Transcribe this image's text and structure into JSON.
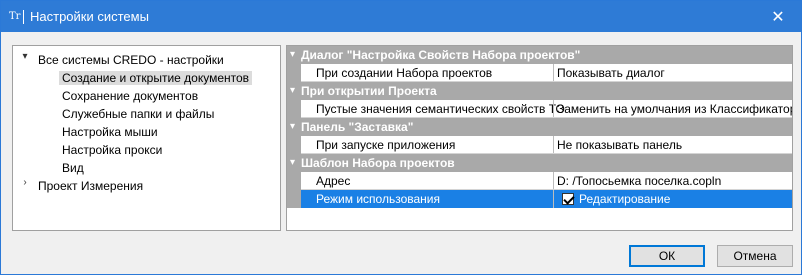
{
  "window": {
    "title": "Настройки системы",
    "icon_text": "Tr",
    "close_glyph": "✕"
  },
  "tree": {
    "root": {
      "label": "Все системы CREDO - настройки",
      "expanded": true
    },
    "children": [
      {
        "label": "Создание и открытие документов",
        "selected": true
      },
      {
        "label": "Сохранение документов"
      },
      {
        "label": "Служебные папки и файлы"
      },
      {
        "label": "Настройка мыши"
      },
      {
        "label": "Настройка прокси"
      },
      {
        "label": "Вид"
      }
    ],
    "second_root": {
      "label": "Проект Измерения",
      "expanded": false
    }
  },
  "grid": {
    "groups": [
      {
        "title": "Диалог \"Настройка Свойств Набора проектов\"",
        "rows": [
          {
            "name": "При создании Набора проектов",
            "value": "Показывать диалог"
          }
        ]
      },
      {
        "title": "При открытии Проекта",
        "rows": [
          {
            "name": "Пустые значения семантических свойств ТО",
            "value": "Заменить на умолчания из Классификатора"
          }
        ]
      },
      {
        "title": "Панель \"Заставка\"",
        "rows": [
          {
            "name": "При запуске приложения",
            "value": "Не показывать панель"
          }
        ]
      },
      {
        "title": "Шаблон Набора проектов",
        "rows": [
          {
            "name": "Адрес",
            "value": "D: /Топосьемка поселка.copln"
          },
          {
            "name": "Режим использования",
            "value": "Редактирование",
            "checked": true,
            "selected": true
          }
        ]
      }
    ]
  },
  "buttons": {
    "ok": "ОК",
    "cancel": "Отмена"
  },
  "colors": {
    "titlebar": "#2e7bd6",
    "group_header": "#a9a9a9",
    "selection": "#1a80e5"
  }
}
